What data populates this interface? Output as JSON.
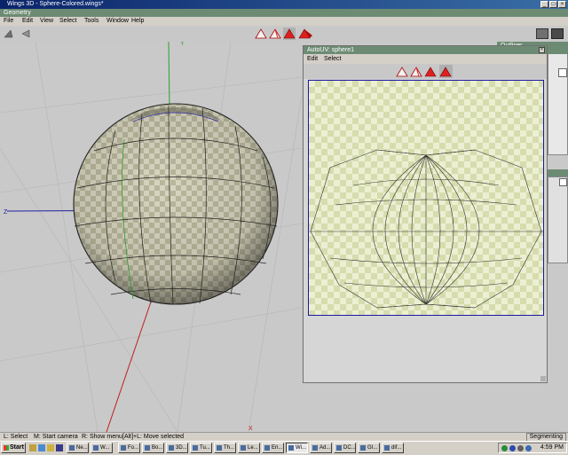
{
  "window": {
    "title": "Wings 3D - Sphere-Colored.wings*",
    "min": "_",
    "max": "□",
    "close": "×"
  },
  "mode_bar": {
    "label": "Geometry"
  },
  "menu": [
    "File",
    "Edit",
    "View",
    "Select",
    "Tools",
    "Window",
    "Help"
  ],
  "viewport": {
    "axis_y": "Y",
    "axis_z": "Z",
    "axis_x": "X"
  },
  "outliner": {
    "title": "Outliner"
  },
  "autouv": {
    "title": "AutoUV: sphere1",
    "menu": [
      "Edit",
      "Select"
    ],
    "close": "×"
  },
  "status": {
    "left_hint": "L: Select",
    "middle_hint": "M: Start camera",
    "right_hint": "R: Show menu",
    "alt_hint": "[Alt]+L: Move selected",
    "mode": "Segmenting"
  },
  "taskbar": {
    "start": "Start",
    "tasks": [
      "Ne...",
      "W...",
      "Fo...",
      "Bo...",
      "3D...",
      "Tu...",
      "Th...",
      "Le...",
      "Eri...",
      "Wi...",
      "Ad...",
      "DC...",
      "GI...",
      "dif..."
    ],
    "clock": "4:59 PM"
  },
  "colors": {
    "title_bar": "#0a246a",
    "mode_bar": "#6d8b73",
    "selection_red": "#e02020",
    "uv_border": "#1a1aa0",
    "viewport": "#c9c9c9"
  }
}
